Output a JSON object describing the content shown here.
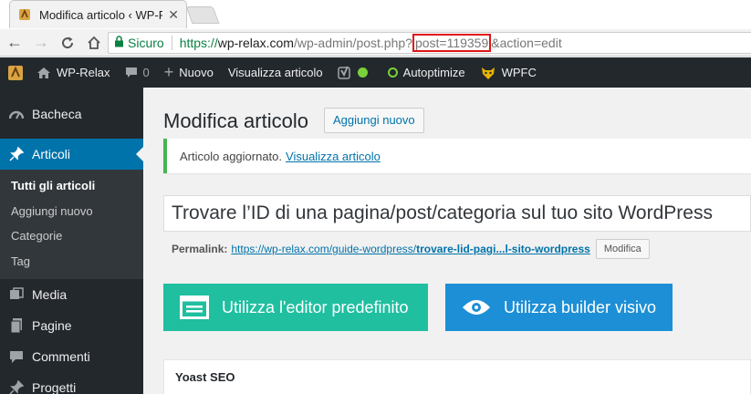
{
  "browser": {
    "tab_title": "Modifica articolo ‹ WP-Re",
    "secure_label": "Sicuro",
    "url": {
      "scheme": "https://",
      "host": "wp-relax.com",
      "path": "/wp-admin/post.php?",
      "highlight": "post=119359",
      "rest": "&action=edit"
    },
    "accent_secure": "#0b8043",
    "highlight_color": "#e01414"
  },
  "adminbar": {
    "site": "WP-Relax",
    "comments_count": "0",
    "new_label": "Nuovo",
    "view_post": "Visualizza articolo",
    "autoptimize": "Autoptimize",
    "wpfc": "WPFC"
  },
  "sidebar": {
    "items": [
      {
        "label": "Bacheca",
        "icon": "dashboard-icon"
      },
      {
        "label": "Articoli",
        "icon": "pushpin-icon"
      },
      {
        "label": "Media",
        "icon": "media-icon"
      },
      {
        "label": "Pagine",
        "icon": "pages-icon"
      },
      {
        "label": "Commenti",
        "icon": "comments-icon"
      },
      {
        "label": "Progetti",
        "icon": "pushpin-icon"
      }
    ],
    "submenu": [
      "Tutti gli articoli",
      "Aggiungi nuovo",
      "Categorie",
      "Tag"
    ]
  },
  "main": {
    "page_title": "Modifica articolo",
    "add_new": "Aggiungi nuovo",
    "notice_text": "Articolo aggiornato.",
    "notice_link": "Visualizza articolo",
    "post_title": "Trovare l’ID di una pagina/post/categoria sul tuo sito WordPress",
    "permalink_label": "Permalink:",
    "permalink_base": "https://wp-relax.com/guide-wordpress/",
    "permalink_slug": "trovare-lid-pagi...l-sito-wordpress",
    "edit_button": "Modifica",
    "default_editor": "Utilizza l'editor predefinito",
    "visual_builder": "Utilizza builder visivo",
    "yoast_title": "Yoast SEO"
  }
}
